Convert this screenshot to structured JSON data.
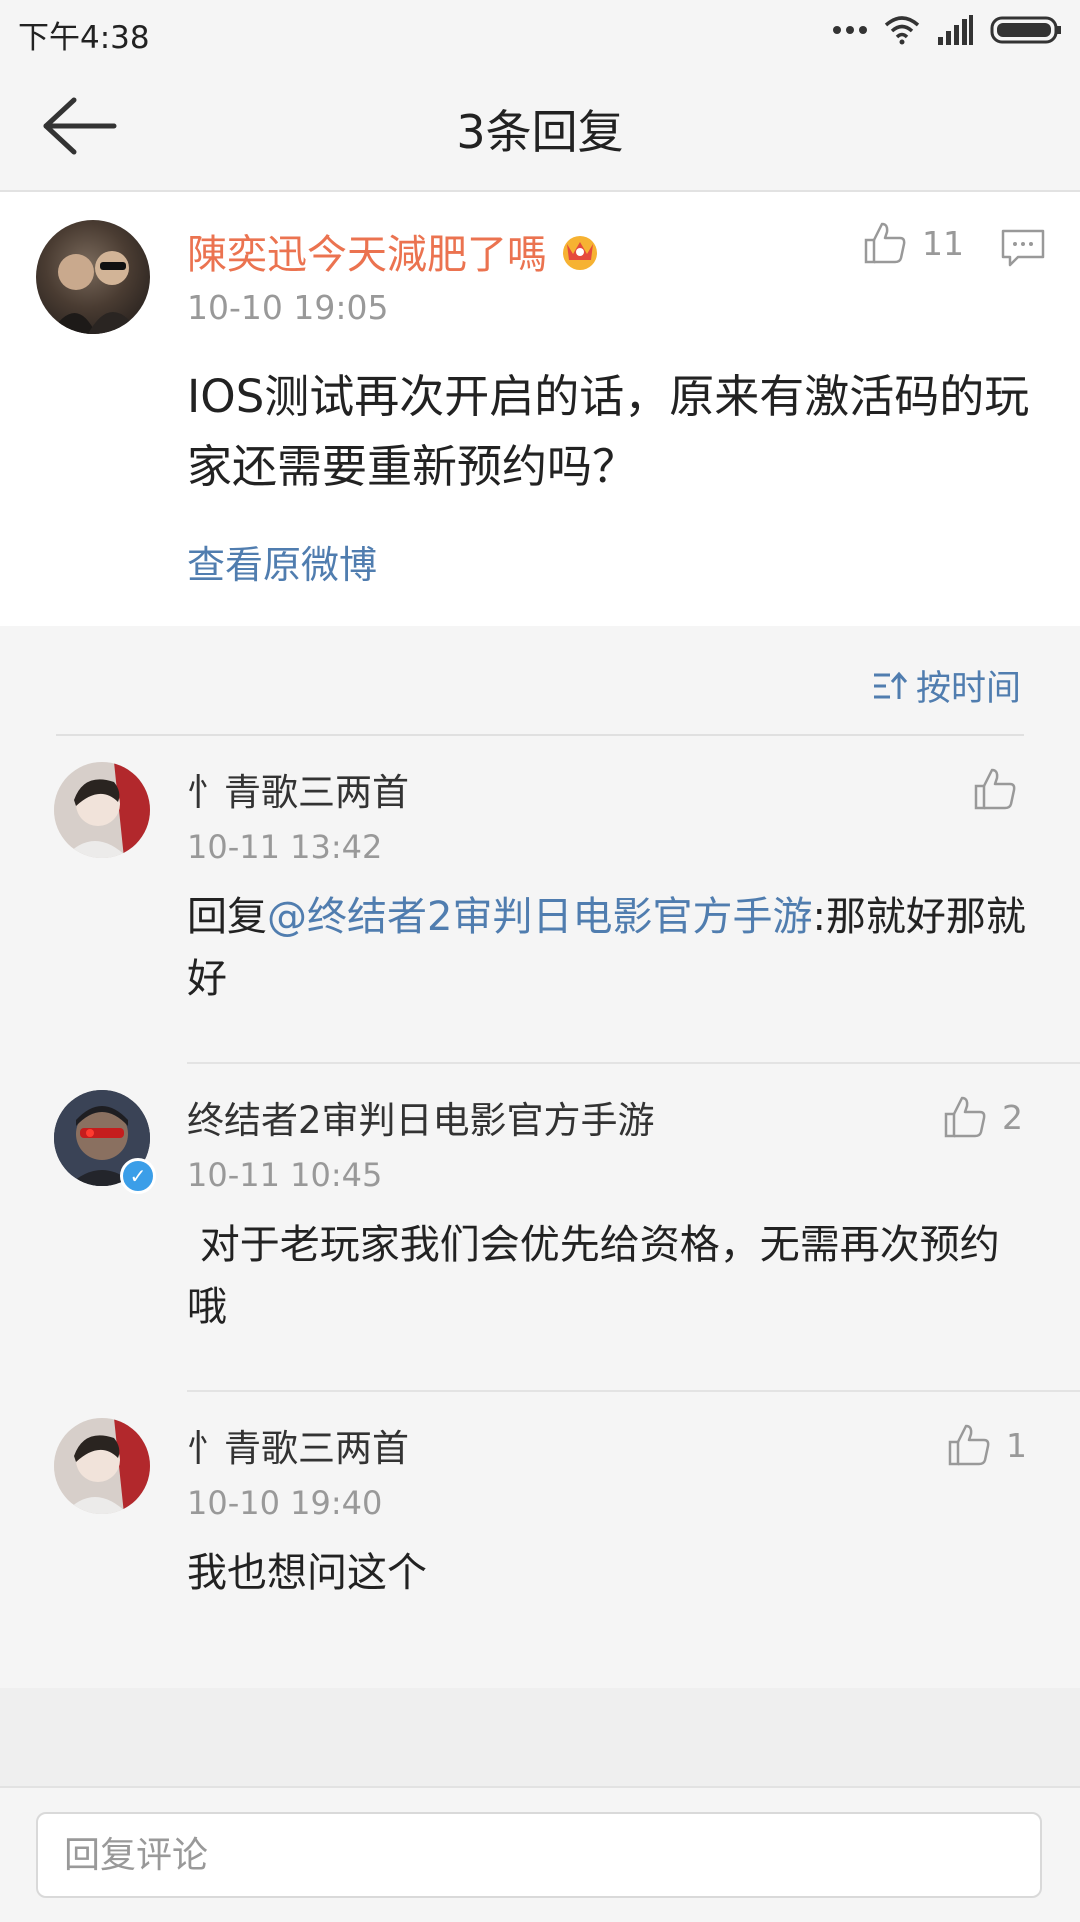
{
  "status": {
    "time": "下午4:38"
  },
  "header": {
    "title": "3条回复"
  },
  "post": {
    "author": "陳奕迅今天減肥了嗎",
    "time": "10-10 19:05",
    "likes": "11",
    "text": "IOS测试再次开启的话，原来有激活码的玩家还需要重新预约吗？",
    "view_original": "查看原微博"
  },
  "sort": {
    "label": "按时间"
  },
  "replies": [
    {
      "author": "忄青歌三两首",
      "time": "10-11 13:42",
      "likes": "",
      "prefix": "回复",
      "mention": "@终结者2审判日电影官方手游",
      "text": ":那就好那就好"
    },
    {
      "author": "终结者2审判日电影官方手游",
      "time": "10-11 10:45",
      "likes": "2",
      "text": " 对于老玩家我们会优先给资格，无需再次预约哦"
    },
    {
      "author": "忄青歌三两首",
      "time": "10-10 19:40",
      "likes": "1",
      "text": "我也想问这个"
    }
  ],
  "composer": {
    "placeholder": "回复评论"
  },
  "colors": {
    "accent": "#507daf",
    "vip_name": "#eb7350",
    "background": "#f5f5f5"
  }
}
